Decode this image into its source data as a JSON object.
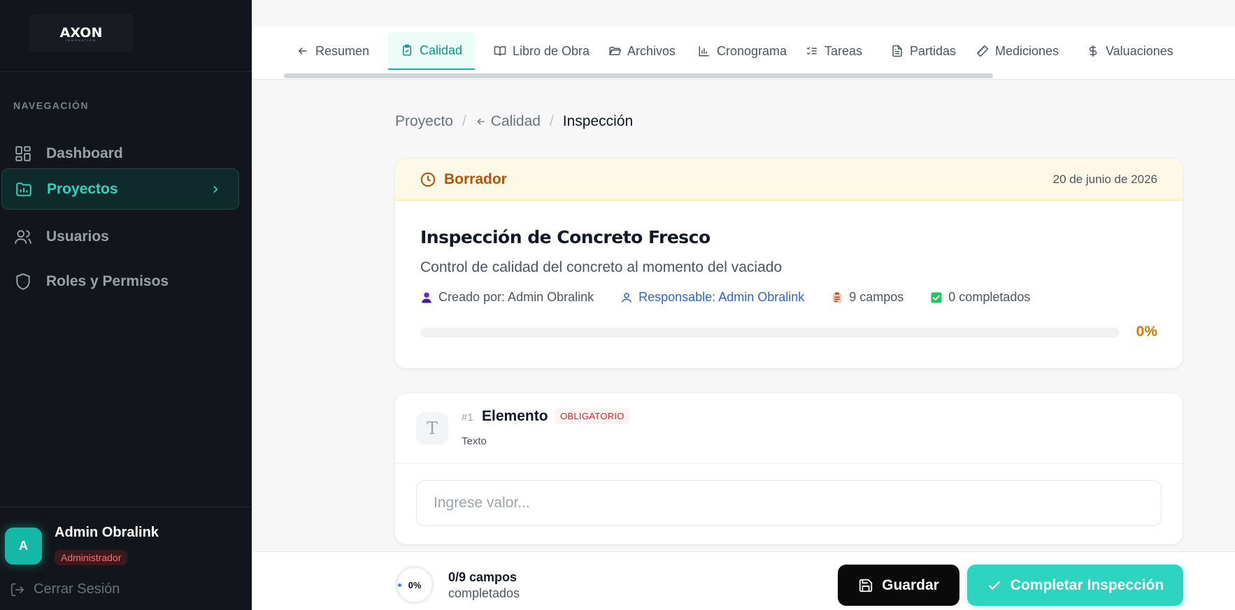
{
  "app": {
    "logo": "AXON",
    "logo_sub": "INNOVATION"
  },
  "sidebar": {
    "heading": "NAVEGACIÓN",
    "items": [
      {
        "label": "Dashboard",
        "icon": "dashboard-icon",
        "active": false
      },
      {
        "label": "Proyectos",
        "icon": "folder-chart-icon",
        "active": true
      },
      {
        "label": "Usuarios",
        "icon": "users-icon",
        "active": false
      },
      {
        "label": "Roles y Permisos",
        "icon": "shield-icon",
        "active": false
      }
    ],
    "user": {
      "initial": "A",
      "name": "Admin Obralink",
      "role": "Administrador"
    },
    "logout_label": "Cerrar Sesión"
  },
  "tabs": [
    {
      "label": "Resumen",
      "icon": "arrow-left-icon"
    },
    {
      "label": "Calidad",
      "icon": "clipboard-check-icon",
      "active": true
    },
    {
      "label": "Libro de Obra",
      "icon": "book-open-icon"
    },
    {
      "label": "Archivos",
      "icon": "folder-open-icon"
    },
    {
      "label": "Cronograma",
      "icon": "bar-chart-icon"
    },
    {
      "label": "Tareas",
      "icon": "list-checks-icon"
    },
    {
      "label": "Partidas",
      "icon": "file-text-icon"
    },
    {
      "label": "Mediciones",
      "icon": "ruler-icon"
    },
    {
      "label": "Valuaciones",
      "icon": "dollar-icon"
    }
  ],
  "breadcrumb": {
    "root": "Proyecto",
    "parent": "Calidad",
    "current": "Inspección",
    "separator": "/"
  },
  "inspection": {
    "status": "Borrador",
    "date": "20 de junio de 2026",
    "title": "Inspección de Concreto Fresco",
    "description": "Control de calidad del concreto al momento del vaciado",
    "created_by": "Creado por: Admin Obralink",
    "responsible": "Responsable: Admin Obralink",
    "fields_count": "9 campos",
    "completed_count": "0 completados",
    "progress": 0,
    "progress_label": "0%"
  },
  "field": {
    "number": "#1",
    "name": "Elemento",
    "badge": "OBLIGATORIO",
    "type": "Texto",
    "icon_glyph": "T",
    "value": "",
    "placeholder": "Ingrese valor..."
  },
  "footer": {
    "ring_label": "0%",
    "count_main": "0/9 campos",
    "count_sub": "completados",
    "save_label": "Guardar",
    "complete_label": "Completar Inspección"
  },
  "colors": {
    "accent": "#2dd4bf",
    "status": "#b45309",
    "link": "#2563eb",
    "danger": "#dc2626"
  }
}
